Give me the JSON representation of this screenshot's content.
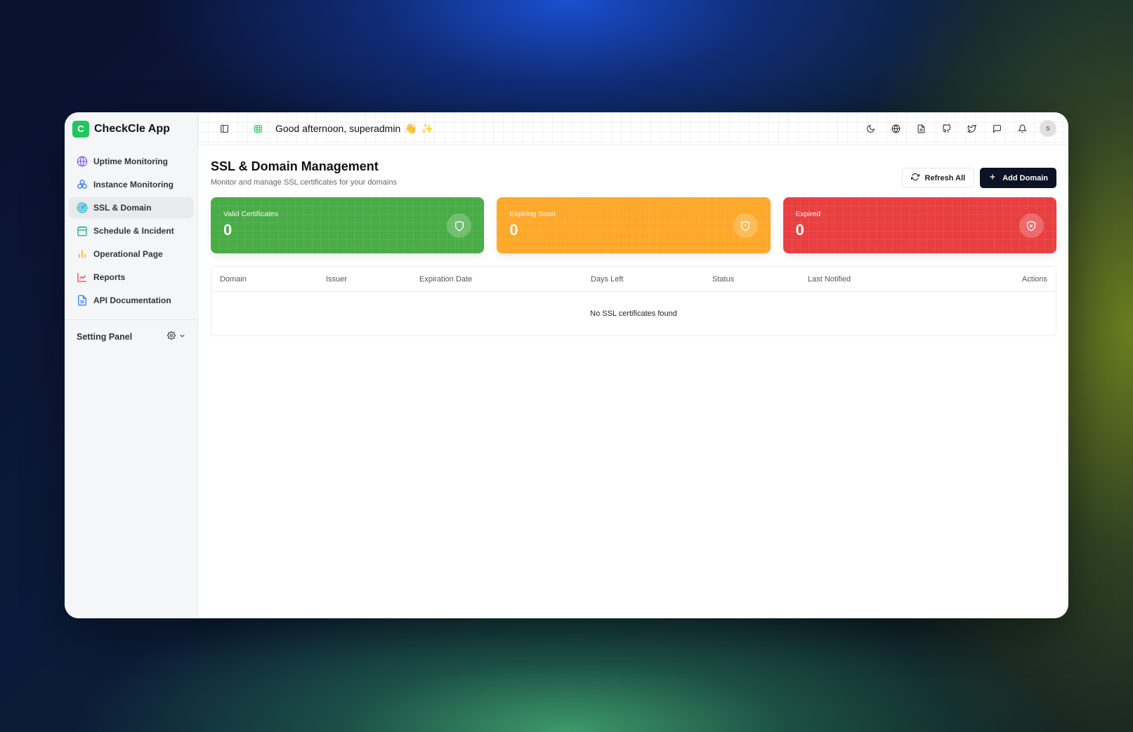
{
  "app": {
    "logo_letter": "C",
    "name": "CheckCle App"
  },
  "sidebar": {
    "items": [
      {
        "label": "Uptime Monitoring",
        "icon": "globe-icon"
      },
      {
        "label": "Instance Monitoring",
        "icon": "boxes-icon"
      },
      {
        "label": "SSL & Domain",
        "icon": "radar-icon"
      },
      {
        "label": "Schedule & Incident",
        "icon": "calendar-icon"
      },
      {
        "label": "Operational Page",
        "icon": "bar-chart-icon"
      },
      {
        "label": "Reports",
        "icon": "line-chart-icon"
      },
      {
        "label": "API Documentation",
        "icon": "document-icon"
      }
    ],
    "setting_label": "Setting Panel"
  },
  "topbar": {
    "greeting": "Good afternoon, superadmin",
    "avatar_letter": "s"
  },
  "page": {
    "title": "SSL & Domain Management",
    "subtitle": "Monitor and manage SSL certificates for your domains",
    "refresh_label": "Refresh All",
    "add_label": "Add Domain"
  },
  "cards": [
    {
      "label": "Valid Certificates",
      "value": "0",
      "color": "#49ac46"
    },
    {
      "label": "Expiring Soon",
      "value": "0",
      "color": "#fda82a"
    },
    {
      "label": "Expired",
      "value": "0",
      "color": "#e93f40"
    }
  ],
  "table": {
    "columns": [
      "Domain",
      "Issuer",
      "Expiration Date",
      "Days Left",
      "Status",
      "Last Notified",
      "Actions"
    ],
    "empty_text": "No SSL certificates found"
  }
}
